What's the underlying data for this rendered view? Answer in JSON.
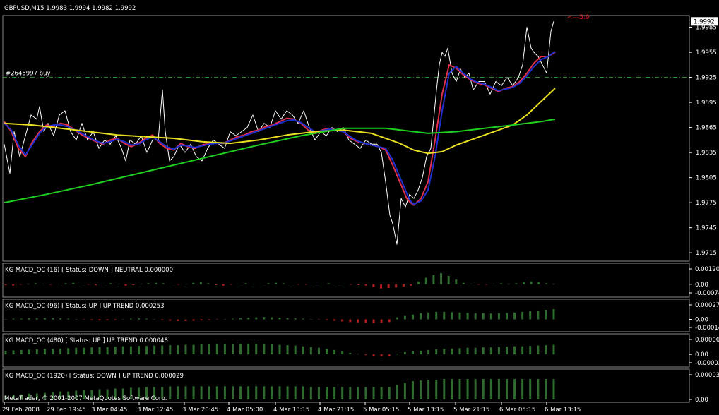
{
  "chart_data": {
    "type": "line",
    "header": "GBPUSD,M15  1.9983 1.9994 1.9982 1.9992",
    "price_axis": {
      "ylim": [
        1.9705,
        1.9999
      ],
      "ticks": [
        "1.9985",
        "1.9955",
        "1.9925",
        "1.9895",
        "1.9865",
        "1.9835",
        "1.9805",
        "1.9775",
        "1.9745",
        "1.9715"
      ],
      "current_price": "1.9992"
    },
    "time_axis_labels": [
      "29 Feb 2008",
      "29 Feb 19:45",
      "3 Mar 04:45",
      "3 Mar 12:45",
      "3 Mar 20:45",
      "4 Mar 05:00",
      "4 Mar 13:15",
      "4 Mar 21:15",
      "5 Mar 05:15",
      "5 Mar 13:15",
      "5 Mar 21:15",
      "6 Mar 05:15",
      "6 Mar 13:15"
    ],
    "order_line": {
      "label": "#2645997 buy",
      "price": 1.9925,
      "color": "#2e9e2e"
    },
    "arrow_label": "<---5:9",
    "series": [
      {
        "color": "#ffffff",
        "x": [
          0,
          8,
          14,
          22,
          30,
          38,
          46,
          50,
          56,
          62,
          70,
          78,
          86,
          94,
          102,
          110,
          118,
          126,
          134,
          142,
          150,
          158,
          166,
          172,
          178,
          186,
          194,
          202,
          210,
          218,
          224,
          228,
          234,
          240,
          248,
          256,
          264,
          272,
          280,
          288,
          296,
          304,
          312,
          320,
          328,
          336,
          344,
          352,
          360,
          368,
          376,
          384,
          392,
          400,
          408,
          416,
          424,
          432,
          440,
          448,
          456,
          464,
          472,
          480,
          488,
          496,
          504,
          512,
          520,
          528,
          534,
          540,
          546,
          550,
          556,
          562,
          568,
          574,
          580,
          586,
          592,
          598,
          604,
          608,
          612,
          616,
          620,
          624,
          628,
          634,
          640,
          646,
          652,
          658,
          664,
          672,
          680,
          688,
          696,
          704,
          712,
          720,
          728,
          734,
          740,
          746,
          750,
          756,
          762,
          768,
          774,
          778
        ],
        "y": [
          1.9845,
          1.981,
          1.986,
          1.983,
          1.9855,
          1.988,
          1.9875,
          1.989,
          1.986,
          1.987,
          1.9855,
          1.988,
          1.9885,
          1.986,
          1.985,
          1.987,
          1.985,
          1.986,
          1.984,
          1.985,
          1.9845,
          1.9855,
          1.984,
          1.9825,
          1.985,
          1.9845,
          1.9855,
          1.9835,
          1.985,
          1.985,
          1.991,
          1.986,
          1.9825,
          1.983,
          1.9845,
          1.9835,
          1.9845,
          1.983,
          1.9825,
          1.984,
          1.985,
          1.9845,
          1.984,
          1.986,
          1.9855,
          1.986,
          1.9865,
          1.988,
          1.986,
          1.987,
          1.9865,
          1.9885,
          1.9875,
          1.9885,
          1.988,
          1.987,
          1.9885,
          1.9865,
          1.985,
          1.986,
          1.9855,
          1.9865,
          1.986,
          1.9865,
          1.985,
          1.9845,
          1.984,
          1.985,
          1.9845,
          1.9845,
          1.9835,
          1.98,
          1.976,
          1.975,
          1.9725,
          1.978,
          1.977,
          1.9785,
          1.978,
          1.979,
          1.9805,
          1.983,
          1.984,
          1.9875,
          1.991,
          1.994,
          1.9955,
          1.995,
          1.996,
          1.993,
          1.992,
          1.9935,
          1.9925,
          1.993,
          1.991,
          1.992,
          1.992,
          1.9905,
          1.992,
          1.9915,
          1.9925,
          1.9915,
          1.9925,
          1.994,
          1.9985,
          1.996,
          1.9955,
          1.995,
          1.994,
          1.993,
          1.998,
          1.9992
        ]
      },
      {
        "color": "#e0304a",
        "x": [
          0,
          10,
          20,
          30,
          40,
          50,
          60,
          70,
          80,
          90,
          100,
          110,
          120,
          130,
          140,
          150,
          160,
          170,
          180,
          190,
          200,
          210,
          220,
          230,
          240,
          250,
          260,
          270,
          280,
          290,
          300,
          310,
          320,
          330,
          340,
          350,
          360,
          370,
          380,
          390,
          400,
          410,
          420,
          430,
          440,
          450,
          460,
          470,
          480,
          490,
          500,
          510,
          520,
          530,
          540,
          550,
          560,
          570,
          575,
          580,
          590,
          600,
          610,
          620,
          630,
          640,
          650,
          660,
          670,
          680,
          690,
          700,
          710,
          720,
          730,
          740,
          750,
          760,
          770,
          780
        ],
        "y": [
          1.9872,
          1.986,
          1.984,
          1.983,
          1.9848,
          1.986,
          1.9868,
          1.9866,
          1.987,
          1.9868,
          1.9862,
          1.9856,
          1.9852,
          1.9848,
          1.9845,
          1.985,
          1.9852,
          1.9846,
          1.9842,
          1.9846,
          1.9852,
          1.9856,
          1.9846,
          1.984,
          1.9838,
          1.9846,
          1.9842,
          1.984,
          1.9844,
          1.9846,
          1.9846,
          1.9846,
          1.985,
          1.9854,
          1.9856,
          1.986,
          1.9862,
          1.9866,
          1.9868,
          1.9872,
          1.9876,
          1.9875,
          1.987,
          1.9862,
          1.9858,
          1.9862,
          1.9864,
          1.9862,
          1.986,
          1.9852,
          1.9848,
          1.9846,
          1.9844,
          1.9842,
          1.9838,
          1.982,
          1.98,
          1.978,
          1.9775,
          1.9772,
          1.978,
          1.98,
          1.985,
          1.9905,
          1.994,
          1.9936,
          1.9928,
          1.9922,
          1.9918,
          1.9916,
          1.9912,
          1.9908,
          1.9912,
          1.9914,
          1.992,
          1.993,
          1.9942,
          1.995,
          1.995,
          1.9955
        ]
      },
      {
        "color": "#2030d0",
        "x": [
          0,
          10,
          20,
          30,
          40,
          50,
          60,
          70,
          80,
          90,
          100,
          110,
          120,
          130,
          140,
          150,
          160,
          170,
          180,
          190,
          200,
          210,
          220,
          230,
          240,
          250,
          260,
          270,
          280,
          290,
          300,
          310,
          320,
          330,
          340,
          350,
          360,
          370,
          380,
          390,
          400,
          410,
          420,
          430,
          440,
          450,
          460,
          470,
          480,
          490,
          500,
          510,
          520,
          530,
          540,
          550,
          560,
          570,
          575,
          580,
          590,
          600,
          610,
          620,
          630,
          640,
          650,
          660,
          670,
          680,
          690,
          700,
          710,
          720,
          730,
          740,
          750,
          760,
          770,
          780
        ],
        "y": [
          1.987,
          1.9862,
          1.9844,
          1.9832,
          1.9845,
          1.9858,
          1.9866,
          1.9868,
          1.9868,
          1.9866,
          1.9862,
          1.9858,
          1.9853,
          1.9849,
          1.9846,
          1.9848,
          1.9851,
          1.9848,
          1.9844,
          1.9845,
          1.985,
          1.9854,
          1.9848,
          1.9842,
          1.9839,
          1.9844,
          1.9843,
          1.9841,
          1.9843,
          1.9845,
          1.9846,
          1.9846,
          1.9849,
          1.9852,
          1.9855,
          1.9858,
          1.9861,
          1.9864,
          1.9867,
          1.987,
          1.9873,
          1.9874,
          1.9871,
          1.9865,
          1.986,
          1.9861,
          1.9863,
          1.9862,
          1.986,
          1.9854,
          1.9849,
          1.9846,
          1.9844,
          1.9842,
          1.984,
          1.9826,
          1.9806,
          1.9786,
          1.9777,
          1.9773,
          1.9777,
          1.979,
          1.983,
          1.9885,
          1.993,
          1.9938,
          1.993,
          1.9923,
          1.9919,
          1.9917,
          1.9913,
          1.9909,
          1.9911,
          1.9913,
          1.9918,
          1.9927,
          1.9938,
          1.9946,
          1.995,
          1.9956
        ]
      },
      {
        "color": "#e8e020",
        "x": [
          0,
          40,
          80,
          120,
          160,
          200,
          240,
          280,
          320,
          360,
          400,
          440,
          480,
          520,
          560,
          580,
          600,
          620,
          640,
          660,
          680,
          700,
          720,
          740,
          760,
          780
        ],
        "y": [
          1.987,
          1.9868,
          1.9864,
          1.986,
          1.9856,
          1.9854,
          1.9852,
          1.9848,
          1.9846,
          1.985,
          1.9856,
          1.986,
          1.9862,
          1.9858,
          1.9846,
          1.9838,
          1.9834,
          1.9836,
          1.9844,
          1.985,
          1.9856,
          1.9862,
          1.9868,
          1.988,
          1.9896,
          1.9912
        ]
      },
      {
        "color": "#20d020",
        "x": [
          0,
          60,
          120,
          180,
          240,
          300,
          360,
          420,
          480,
          540,
          580,
          600,
          640,
          680,
          720,
          760,
          780
        ],
        "y": [
          1.9775,
          1.9785,
          1.9796,
          1.9808,
          1.982,
          1.9832,
          1.9844,
          1.9855,
          1.9864,
          1.9864,
          1.986,
          1.9858,
          1.986,
          1.9864,
          1.9868,
          1.9872,
          1.9875
        ]
      }
    ],
    "subpanels": [
      {
        "name": "KG MACD_OC",
        "period": "(16)",
        "status": "[ Status: DOWN ]",
        "trend": "NEUTRAL",
        "value": "0.000000",
        "ticks": [
          "0.00120",
          "0.00",
          "-0.00074"
        ],
        "hist": [
          -2,
          -3,
          -1,
          1,
          2,
          1,
          -1,
          1,
          2,
          3,
          1,
          -1,
          -2,
          1,
          2,
          1,
          -3,
          -2,
          1,
          2,
          3,
          2,
          1,
          -1,
          1,
          3,
          4,
          2,
          -2,
          -3,
          -1,
          1,
          2,
          1,
          1,
          2,
          3,
          2,
          1,
          -1,
          -1,
          1,
          1,
          2,
          1,
          1,
          -1,
          -2,
          -3,
          -6,
          -9,
          -8,
          -7,
          -5,
          -3,
          6,
          14,
          20,
          24,
          18,
          10,
          3,
          1,
          -1,
          -1,
          1,
          2,
          1,
          2,
          4,
          6,
          4,
          2,
          1
        ]
      },
      {
        "name": "KG MACD_OC",
        "period": "(96)",
        "status": "[ Status: UP ]",
        "trend": "UP TREND",
        "value": "0.000253",
        "ticks": [
          "0.00027",
          "0.00",
          "-0.00014"
        ],
        "hist": [
          1,
          2,
          2,
          3,
          3,
          4,
          4,
          3,
          2,
          1,
          -1,
          -2,
          -3,
          -3,
          -2,
          1,
          2,
          3,
          2,
          1,
          -2,
          -4,
          -5,
          -5,
          -4,
          -3,
          -2,
          -1,
          1,
          2,
          4,
          5,
          6,
          7,
          6,
          5,
          4,
          3,
          2,
          1,
          -1,
          -2,
          -4,
          -6,
          -8,
          -9,
          -10,
          -11,
          -10,
          -8,
          6,
          10,
          14,
          18,
          20,
          22,
          22,
          21,
          20,
          19,
          18,
          18,
          17,
          18,
          19,
          20,
          22,
          24,
          26,
          28,
          30
        ]
      },
      {
        "name": "KG MACD_OC",
        "period": "(480)",
        "status": "[ Status: UP ]",
        "trend": "UP TREND",
        "value": "0.000048",
        "ticks": [
          "0.00006",
          "0.00",
          "-0.00002"
        ],
        "hist": [
          10,
          11,
          12,
          13,
          14,
          15,
          15,
          16,
          17,
          18,
          18,
          19,
          20,
          20,
          21,
          22,
          22,
          23,
          23,
          24,
          24,
          25,
          25,
          26,
          26,
          27,
          27,
          28,
          28,
          28,
          29,
          29,
          29,
          28,
          27,
          26,
          25,
          24,
          22,
          20,
          18,
          15,
          12,
          8,
          4,
          1,
          -2,
          -4,
          -5,
          -4,
          2,
          6,
          8,
          10,
          12,
          14,
          15,
          16,
          17,
          18,
          18,
          19,
          19,
          20,
          21,
          22,
          22,
          23,
          24,
          25,
          26
        ]
      },
      {
        "name": "KG MACD_OC",
        "period": "(1920)",
        "status": "[ Status: DOWN ]",
        "trend": "UP TREND",
        "value": "0.000029",
        "ticks": [
          "0.00003",
          "0.00"
        ],
        "hist": [
          5,
          6,
          7,
          8,
          8,
          9,
          10,
          11,
          11,
          12,
          13,
          13,
          14,
          14,
          15,
          15,
          16,
          16,
          17,
          17,
          17,
          18,
          18,
          18,
          18,
          18,
          18,
          18,
          18,
          18,
          18,
          18,
          18,
          18,
          18,
          18,
          18,
          18,
          18,
          17,
          17,
          17,
          17,
          17,
          17,
          17,
          17,
          17,
          17,
          17,
          20,
          23,
          25,
          26,
          27,
          27,
          28,
          28,
          28,
          28,
          28,
          28,
          28,
          28,
          28,
          28,
          28,
          28,
          28,
          28,
          28
        ]
      }
    ],
    "copyright": "MetaTrader, © 2001-2007 MetaQuotes Software Corp."
  }
}
